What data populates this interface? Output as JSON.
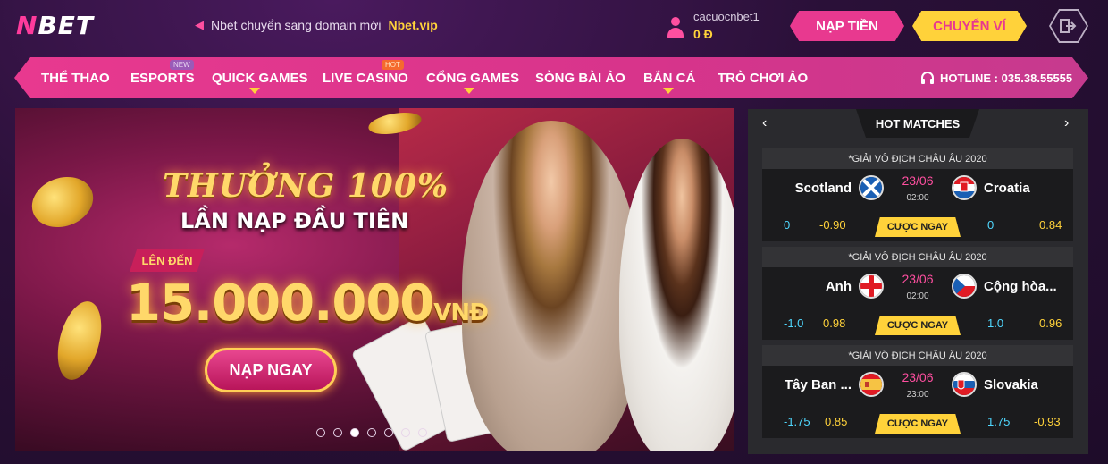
{
  "header": {
    "logo": "NBET",
    "announcement": "Nbet chuyển sang domain mới",
    "announcement_domain": "Nbet.vip",
    "username": "cacuocnbet1",
    "balance": "0 Đ",
    "deposit_label": "NẠP TIỀN",
    "transfer_label": "CHUYỂN VÍ"
  },
  "nav": {
    "items": [
      {
        "label": "THỂ THAO"
      },
      {
        "label": "ESPORTS",
        "badge": "NEW"
      },
      {
        "label": "QUICK GAMES"
      },
      {
        "label": "LIVE CASINO",
        "badge": "HOT"
      },
      {
        "label": "CỔNG GAMES"
      },
      {
        "label": "SÒNG BÀI ẢO"
      },
      {
        "label": "BẮN CÁ"
      },
      {
        "label": "TRÒ CHƠI ẢO"
      }
    ],
    "hotline": "HOTLINE : 035.38.55555"
  },
  "banner": {
    "headline": "THƯỞNG 100%",
    "subheadline": "LẦN NẠP ĐẦU TIÊN",
    "up_to": "LÊN ĐẾN",
    "amount": "15.000.000",
    "currency": "VNĐ",
    "cta": "NẠP NGAY",
    "slide_count": 7,
    "active_slide": 3
  },
  "hot_matches": {
    "title": "HOT MATCHES",
    "matches": [
      {
        "league": "*GIẢI VÔ ĐỊCH CHÂU ÂU 2020",
        "home": "Scotland",
        "away": "Croatia",
        "date": "23/06",
        "time": "02:00",
        "bet_label": "CƯỢC NGAY",
        "home_hcap": "0",
        "home_odds": "-0.90",
        "away_hcap": "0",
        "away_odds": "0.84"
      },
      {
        "league": "*GIẢI VÔ ĐỊCH CHÂU ÂU 2020",
        "home": "Anh",
        "away": "Cộng hòa...",
        "date": "23/06",
        "time": "02:00",
        "bet_label": "CƯỢC NGAY",
        "home_hcap": "-1.0",
        "home_odds": "0.98",
        "away_hcap": "1.0",
        "away_odds": "0.96"
      },
      {
        "league": "*GIẢI VÔ ĐỊCH CHÂU ÂU 2020",
        "home": "Tây Ban ...",
        "away": "Slovakia",
        "date": "23/06",
        "time": "23:00",
        "bet_label": "CƯỢC NGAY",
        "home_hcap": "-1.75",
        "home_odds": "0.85",
        "away_hcap": "1.75",
        "away_odds": "-0.93"
      }
    ]
  },
  "colors": {
    "accent_pink": "#e8398f",
    "accent_yellow": "#ffd23a",
    "odds_cyan": "#4fd8ff"
  }
}
